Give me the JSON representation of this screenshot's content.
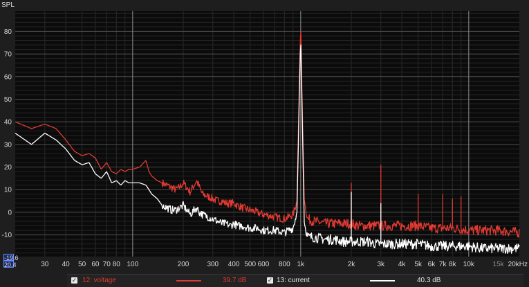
{
  "chart_data": {
    "type": "line",
    "ylabel": "SPL",
    "xlabel": "",
    "x_scale": "log",
    "xlim": [
      20,
      20000
    ],
    "ylim": [
      -19.6,
      89
    ],
    "yticks": [
      80,
      70,
      60,
      50,
      40,
      30,
      20,
      10,
      0,
      -10
    ],
    "xticks": [
      {
        "value": 30,
        "label": "30"
      },
      {
        "value": 40,
        "label": "40"
      },
      {
        "value": 50,
        "label": "50"
      },
      {
        "value": 60,
        "label": "60"
      },
      {
        "value": 70,
        "label": "70"
      },
      {
        "value": 80,
        "label": "80"
      },
      {
        "value": 100,
        "label": "100"
      },
      {
        "value": 200,
        "label": "200"
      },
      {
        "value": 300,
        "label": "300"
      },
      {
        "value": 400,
        "label": "400"
      },
      {
        "value": 500,
        "label": "500"
      },
      {
        "value": 600,
        "label": "600"
      },
      {
        "value": 800,
        "label": "800"
      },
      {
        "value": 1000,
        "label": "1k"
      },
      {
        "value": 2000,
        "label": "2k"
      },
      {
        "value": 3000,
        "label": "3k"
      },
      {
        "value": 4000,
        "label": "4k"
      },
      {
        "value": 5000,
        "label": "5k"
      },
      {
        "value": 6000,
        "label": "6k"
      },
      {
        "value": 7000,
        "label": "7k"
      },
      {
        "value": 8000,
        "label": "8k"
      },
      {
        "value": 10000,
        "label": "10k"
      },
      {
        "value": 15000,
        "label": "15k"
      },
      {
        "value": 20000,
        "label": "20kHz"
      }
    ],
    "grid": true,
    "legend_position": "bottom",
    "series": [
      {
        "name": "12: voltage",
        "color": "#e03a32",
        "x": [
          20,
          25,
          30,
          35,
          40,
          45,
          50,
          55,
          60,
          65,
          70,
          75,
          80,
          85,
          90,
          95,
          100,
          110,
          120,
          125,
          130,
          140,
          150,
          160,
          170,
          180,
          190,
          200,
          220,
          240,
          250,
          260,
          280,
          300,
          320,
          340,
          360,
          380,
          400,
          420,
          450,
          500,
          550,
          600,
          700,
          800,
          900,
          950,
          980,
          1000,
          1020,
          1050,
          1100,
          1200,
          1400,
          1600,
          1800,
          2000,
          2200,
          2500,
          2800,
          3000,
          3500,
          4000,
          5000,
          6000,
          7000,
          8000,
          10000,
          12000,
          15000,
          20000
        ],
        "values": [
          40,
          37,
          39,
          37,
          32,
          27,
          25,
          26,
          24,
          19,
          22,
          18,
          17,
          19,
          18,
          19,
          19,
          20,
          23,
          18,
          16,
          14,
          13,
          12,
          11,
          10,
          11,
          13,
          9,
          14,
          11,
          8,
          7,
          6,
          5,
          5,
          4,
          4,
          4,
          3,
          2,
          1,
          0,
          -1,
          -2,
          -3,
          -1,
          5,
          55,
          84,
          50,
          5,
          -3,
          -4,
          -5,
          -5,
          -5,
          -5,
          -6,
          -6,
          -6,
          -6,
          -6,
          -6,
          -6,
          -7,
          -7,
          -7,
          -8,
          -8,
          -8,
          -9
        ]
      },
      {
        "name": "13: current",
        "color": "#ffffff",
        "x": [
          20,
          25,
          30,
          35,
          40,
          45,
          50,
          55,
          60,
          65,
          70,
          75,
          80,
          85,
          90,
          95,
          100,
          110,
          120,
          125,
          130,
          140,
          150,
          160,
          170,
          180,
          190,
          200,
          220,
          240,
          250,
          260,
          280,
          300,
          320,
          340,
          360,
          380,
          400,
          420,
          450,
          500,
          550,
          600,
          700,
          800,
          900,
          950,
          980,
          1000,
          1020,
          1050,
          1100,
          1200,
          1400,
          1600,
          1800,
          2000,
          2200,
          2500,
          2800,
          3000,
          3500,
          4000,
          5000,
          6000,
          7000,
          8000,
          10000,
          12000,
          15000,
          20000
        ],
        "values": [
          35,
          30,
          35,
          32,
          28,
          23,
          21,
          22,
          17,
          15,
          18,
          13,
          14,
          12,
          14,
          13,
          13,
          13,
          12,
          10,
          8,
          6,
          3,
          2,
          1,
          1,
          2,
          3,
          -1,
          2,
          0,
          -1,
          -2,
          -3,
          -4,
          -5,
          -5,
          -6,
          -5,
          -6,
          -6,
          -7,
          -7,
          -8,
          -8,
          -9,
          -7,
          0,
          50,
          78,
          45,
          -5,
          -11,
          -11,
          -12,
          -12,
          -13,
          -13,
          -13,
          -13,
          -14,
          -14,
          -14,
          -14,
          -14,
          -15,
          -15,
          -15,
          -15,
          -16,
          -16,
          -16
        ]
      }
    ],
    "spikes": [
      {
        "series": 0,
        "x": 2000,
        "value": 13
      },
      {
        "series": 0,
        "x": 3000,
        "value": 21
      },
      {
        "series": 0,
        "x": 5000,
        "value": 8
      },
      {
        "series": 0,
        "x": 7000,
        "value": 8
      },
      {
        "series": 0,
        "x": 8000,
        "value": 6
      },
      {
        "series": 0,
        "x": 9000,
        "value": 7
      },
      {
        "series": 1,
        "x": 2000,
        "value": 9
      },
      {
        "series": 1,
        "x": 3000,
        "value": 4
      }
    ]
  },
  "cursors": {
    "y_readout": "-19.6",
    "x_readout": "20.4"
  },
  "legend": [
    {
      "checked": "✓",
      "label": "12: voltage",
      "value": "39.7 dB",
      "color": "#e03a32"
    },
    {
      "checked": "✓",
      "label": "13: current",
      "value": "40.3 dB",
      "color": "#ffffff"
    }
  ]
}
